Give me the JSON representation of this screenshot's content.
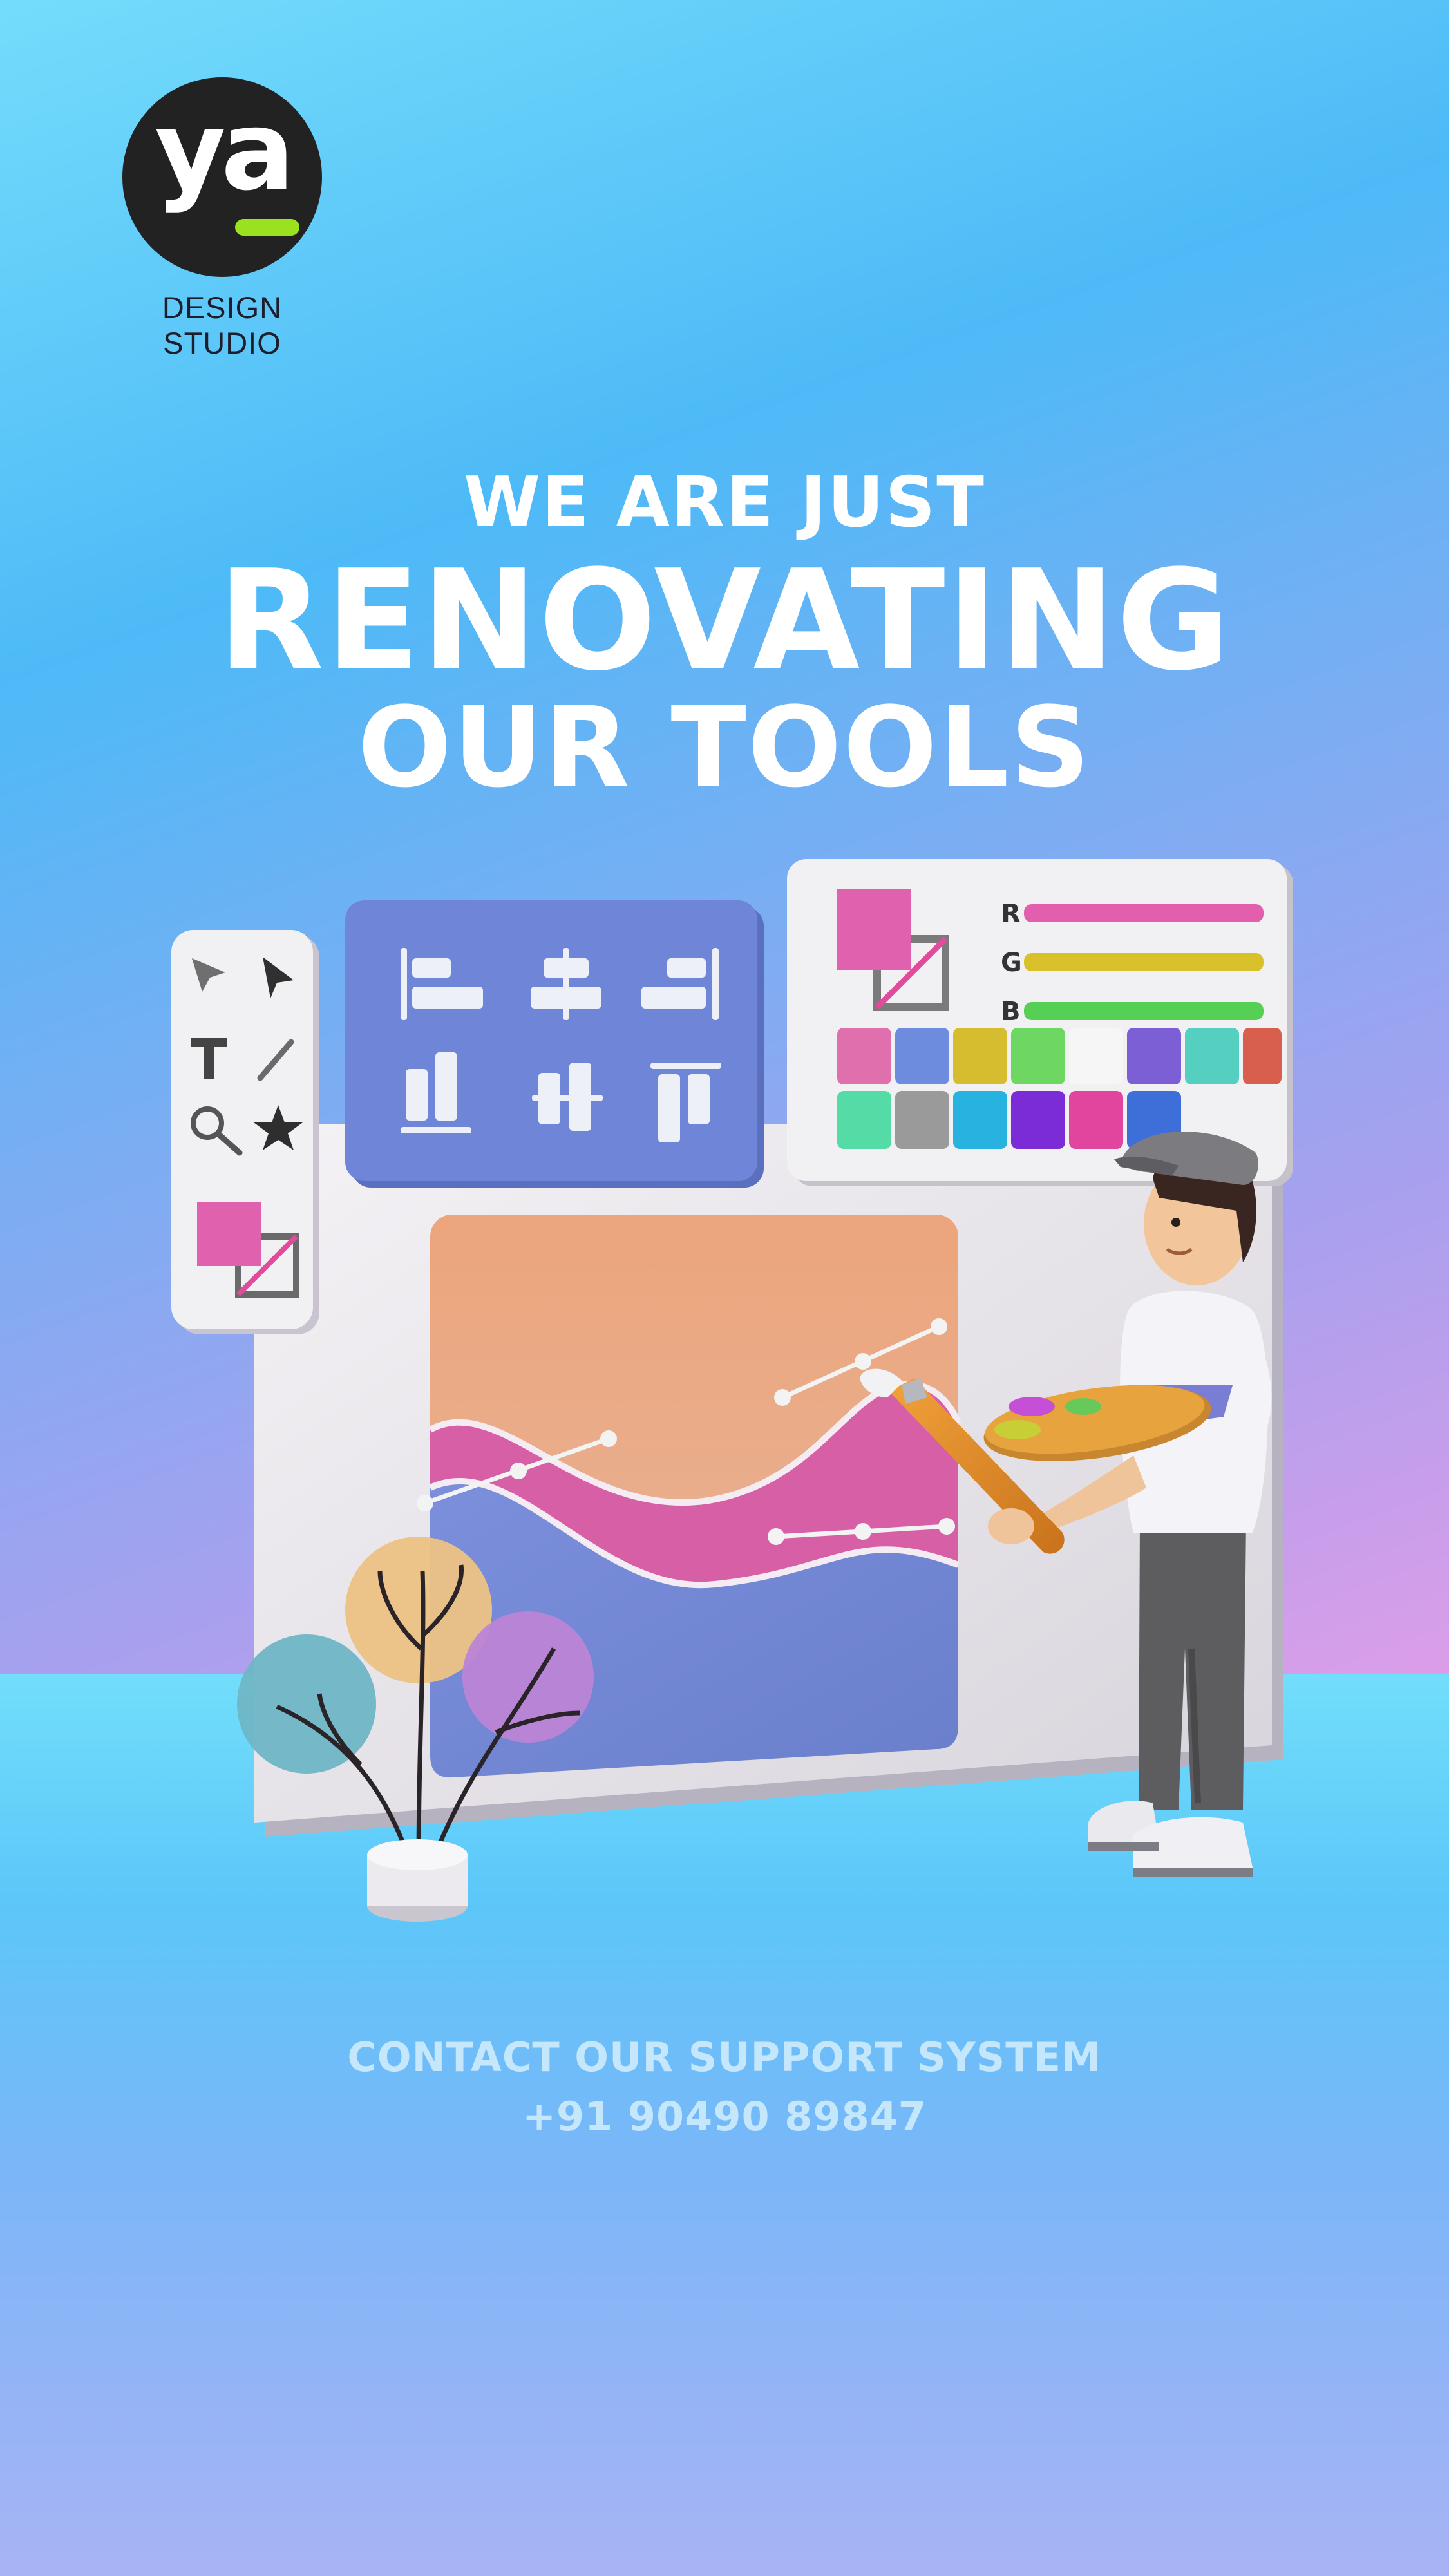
{
  "brand": {
    "logo_text": "ya",
    "caption": "DESIGN STUDIO"
  },
  "headline": {
    "line1": "WE ARE JUST",
    "line2": "RENOVATING",
    "line3": "OUR TOOLS"
  },
  "color_panel": {
    "r_label": "R",
    "g_label": "G",
    "b_label": "B"
  },
  "contact": {
    "line1": "CONTACT OUR SUPPORT SYSTEM",
    "phone": "+91 90490 89847"
  },
  "colors": {
    "headline_text": "#ffffff",
    "contact_text": "#c4e7fb",
    "logo_accent": "#9be21e",
    "logo_background": "#222222"
  }
}
